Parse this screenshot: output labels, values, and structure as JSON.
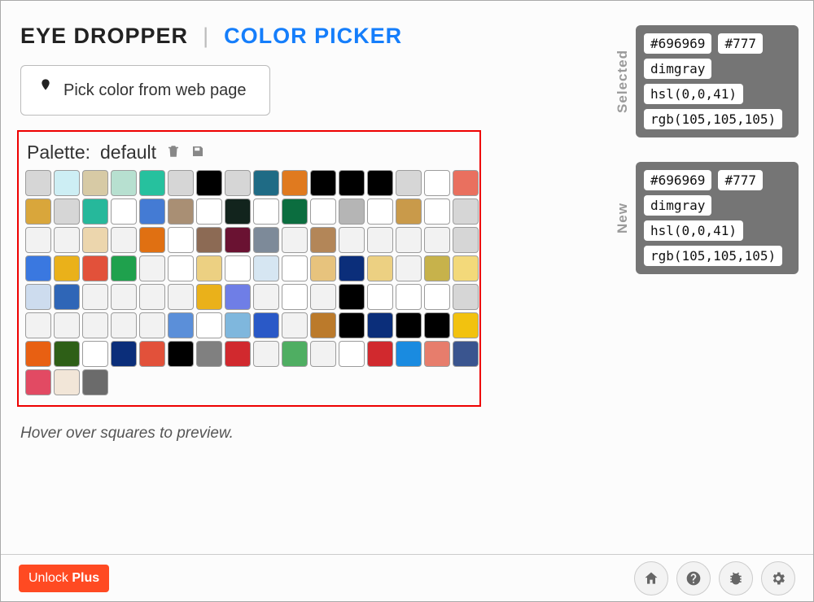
{
  "header": {
    "tab1": "EYE DROPPER",
    "sep": "|",
    "tab2": "COLOR PICKER"
  },
  "pick_button": "Pick color from web page",
  "palette": {
    "label": "Palette:",
    "name": "default"
  },
  "hint": "Hover over squares to preview.",
  "unlock": {
    "pre": "Unlock ",
    "bold": "Plus"
  },
  "selected": {
    "label": "Selected",
    "hex": "#696969",
    "short": "#777",
    "name": "dimgray",
    "hsl": "hsl(0,0,41)",
    "rgb": "rgb(105,105,105)"
  },
  "new": {
    "label": "New",
    "hex": "#696969",
    "short": "#777",
    "name": "dimgray",
    "hsl": "hsl(0,0,41)",
    "rgb": "rgb(105,105,105)"
  },
  "swatches": [
    "#d6d6d6",
    "#cdeef4",
    "#d7caa5",
    "#b7e0d0",
    "#26c19e",
    "#d6d6d6",
    "#000000",
    "#d6d6d6",
    "#1f6b85",
    "#e07a1f",
    "#000000",
    "#000000",
    "#000000",
    "#d6d6d6",
    "#ffffff",
    "#e9705f",
    "#d9a63b",
    "#d6d6d6",
    "#26b89b",
    "#ffffff",
    "#447bd4",
    "#a98f74",
    "#ffffff",
    "#12241d",
    "#ffffff",
    "#0b6d3f",
    "#ffffff",
    "#b5b5b5",
    "#ffffff",
    "#c99a4a",
    "#ffffff",
    "#d6d6d6",
    "#f2f2f2",
    "#f2f2f2",
    "#ecd6ad",
    "#f2f2f2",
    "#e07012",
    "#ffffff",
    "#8c6a54",
    "#6a1232",
    "#7d8a99",
    "#f2f2f2",
    "#b38658",
    "#f2f2f2",
    "#f2f2f2",
    "#f2f2f2",
    "#f2f2f2",
    "#d6d6d6",
    "#3a78e0",
    "#eab11a",
    "#e2513a",
    "#1fa14d",
    "#f2f2f2",
    "#ffffff",
    "#ecd082",
    "#ffffff",
    "#d6e6f2",
    "#ffffff",
    "#e7c37d",
    "#0b2e7a",
    "#ecd082",
    "#f2f2f2",
    "#c7b24b",
    "#f3d97a",
    "#cddcee",
    "#2f66b7",
    "#f2f2f2",
    "#f2f2f2",
    "#f2f2f2",
    "#f2f2f2",
    "#eab11a",
    "#6f7ee6",
    "#f2f2f2",
    "#ffffff",
    "#f2f2f2",
    "#000000",
    "#ffffff",
    "#ffffff",
    "#ffffff",
    "#d6d6d6",
    "#f2f2f2",
    "#f2f2f2",
    "#f2f2f2",
    "#f2f2f2",
    "#f2f2f2",
    "#5b8fd9",
    "#ffffff",
    "#7fb7dd",
    "#2a59c7",
    "#f2f2f2",
    "#bb7a2b",
    "#000000",
    "#0b2e7a",
    "#000000",
    "#000000",
    "#f2c20f",
    "#e86012",
    "#2e5f17",
    "#ffffff",
    "#0b2e7a",
    "#e2513a",
    "#000000",
    "#808080",
    "#d1292e",
    "#f2f2f2",
    "#4fae62",
    "#f2f2f2",
    "#ffffff",
    "#d1292e",
    "#1a8be0",
    "#e77d6c",
    "#3a558f",
    "#e24a63",
    "#f2e6d8",
    "#6b6b6b"
  ]
}
